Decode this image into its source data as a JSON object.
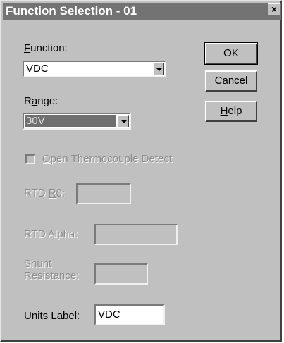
{
  "window": {
    "title": "Function Selection - 01",
    "close_glyph": "×"
  },
  "function": {
    "label_access": "F",
    "label_rest": "unction:",
    "value": "VDC"
  },
  "range": {
    "label_pre": "R",
    "label_access": "a",
    "label_rest": "nge:",
    "value": "30V"
  },
  "buttons": {
    "ok": "OK",
    "cancel": "Cancel",
    "help_access": "H",
    "help_rest": "elp"
  },
  "thermocouple": {
    "label_access": "O",
    "label_rest": "pen Thermocouple Detect",
    "checked": false
  },
  "rtd_r0": {
    "label_pre": "RTD ",
    "label_access": "R",
    "label_rest": "0:",
    "value": ""
  },
  "rtd_alpha": {
    "label": "RTD Alpha:",
    "value": ""
  },
  "shunt": {
    "label_line1": "Shunt",
    "label_line2": "Resistance:",
    "value": ""
  },
  "units": {
    "label_access": "U",
    "label_rest": "nits Label:",
    "value": "VDC"
  },
  "colors": {
    "titlebar": "#737373",
    "face": "#c0c0c0",
    "disabled_text": "#8c8c8c"
  },
  "icons": {
    "dropdown": "chevron-down-icon",
    "close": "close-icon"
  }
}
